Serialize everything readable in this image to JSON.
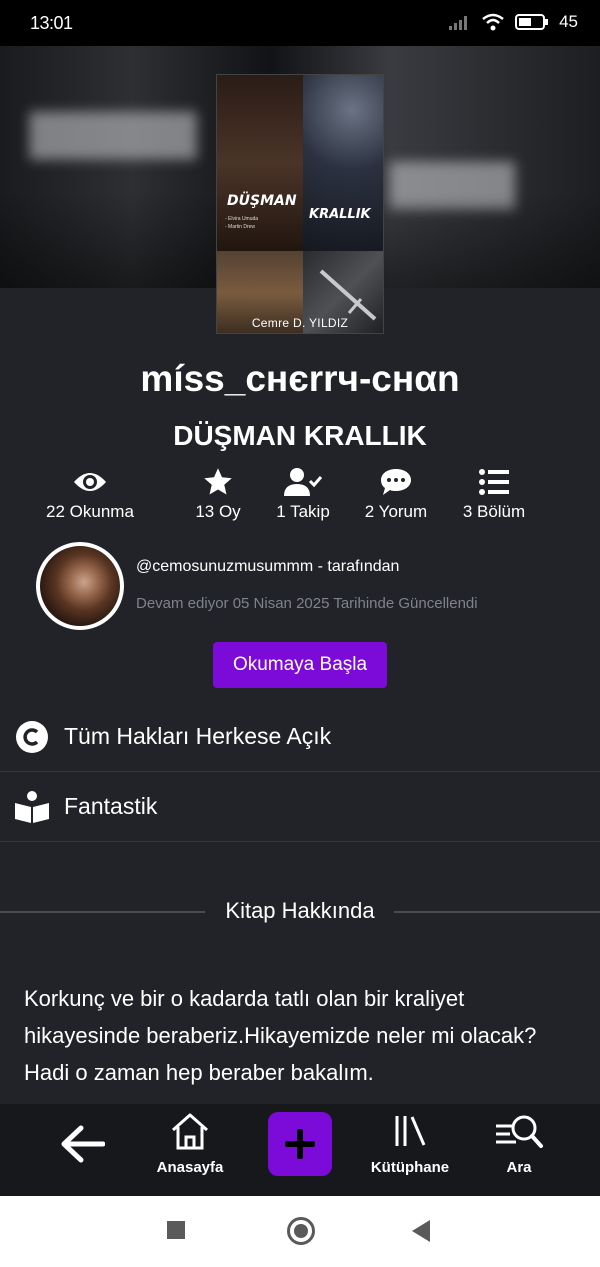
{
  "status_bar": {
    "time": "13:01",
    "battery": "45"
  },
  "book": {
    "cover_title_1": "DÜŞMAN",
    "cover_title_2": "KRALLIK",
    "cover_small_1": "- Elvira Umuda",
    "cover_small_2": "- Martin Drew",
    "cover_author": "Cemre  D. YILDIZ",
    "username": "míss_cнєrrч-cнαn",
    "title": "DÜŞMAN KRALLIK"
  },
  "stats": [
    {
      "icon": "eye-icon",
      "label": "22 Okunma"
    },
    {
      "icon": "star-icon",
      "label": "13 Oy"
    },
    {
      "icon": "user-check-icon",
      "label": "1 Takip"
    },
    {
      "icon": "comment-icon",
      "label": "2 Yorum"
    },
    {
      "icon": "list-icon",
      "label": "3 Bölüm"
    }
  ],
  "author": {
    "handle": "@cemosunuzmusummm - tarafından",
    "status": "Devam ediyor 05 Nisan 2025 Tarihinde Güncellendi"
  },
  "read_button": "Okumaya Başla",
  "license": {
    "icon": "copyright-icon",
    "text": "Tüm Hakları Herkese Açık"
  },
  "genre": {
    "icon": "reader-icon",
    "text": "Fantastik"
  },
  "about_title": "Kitap Hakkında",
  "description": "Korkunç ve bir o kadarda tatlı olan bir kraliyet hikayesinde beraberiz.Hikayemizde neler mi olacak?Hadi o zaman hep beraber bakalım.",
  "nav": {
    "home": "Anasayfa",
    "library": "Kütüphane",
    "search": "Ara"
  },
  "colors": {
    "accent": "#7c0ad8",
    "background": "#212328",
    "nav_bg": "#17181c"
  }
}
